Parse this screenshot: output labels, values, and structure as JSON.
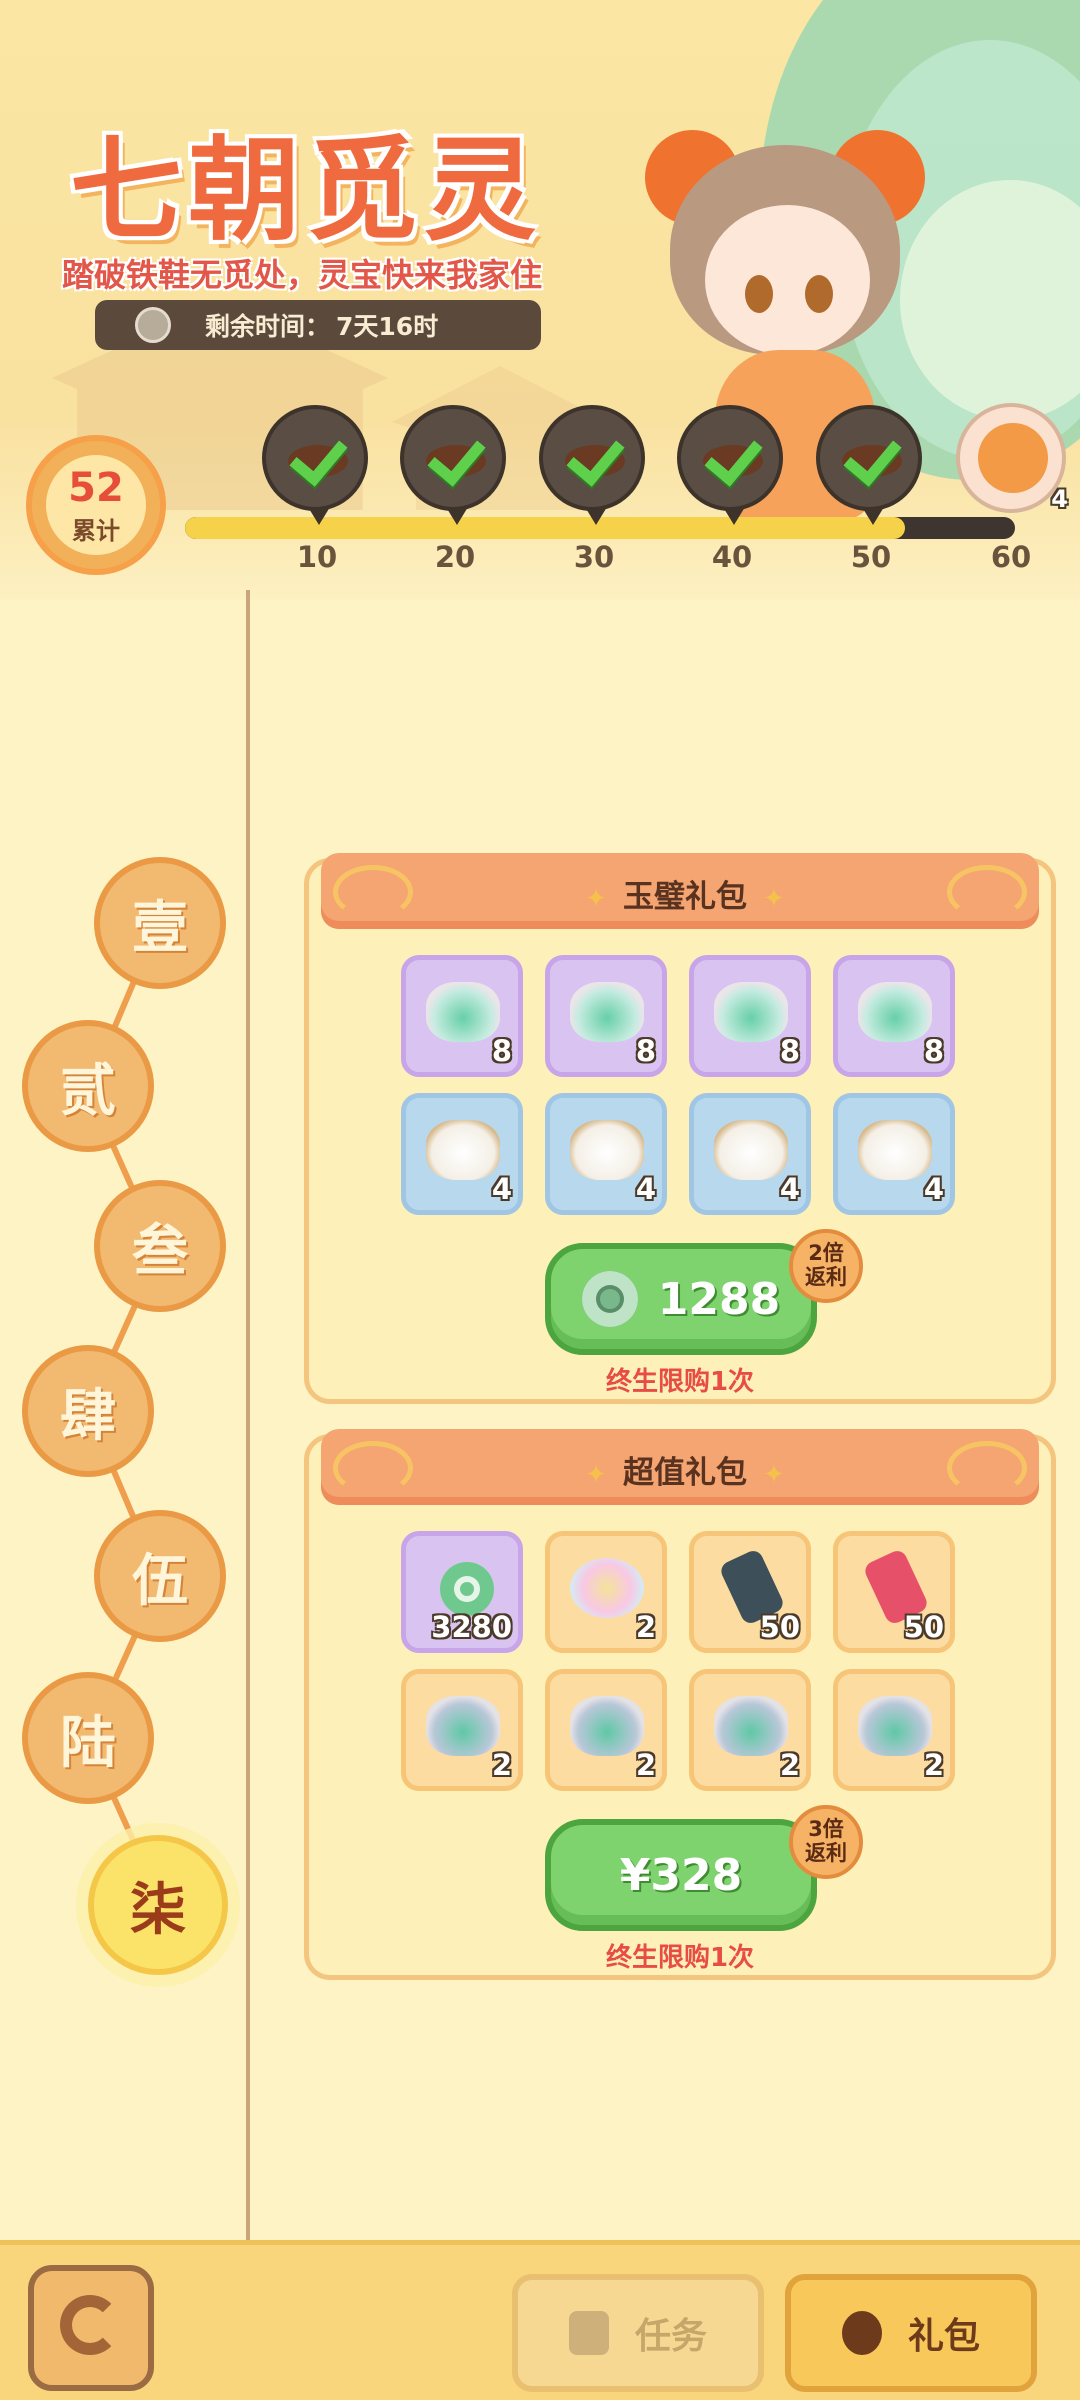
{
  "header": {
    "title": "七朝觅灵",
    "subtitle": "踏破铁鞋无觅处，灵宝快来我家住",
    "timer_label": "剩余时间：",
    "timer_value": "7天16时"
  },
  "progress": {
    "count": "52",
    "count_label": "累计",
    "fraction": 0.867,
    "milestones": [
      {
        "label": "10",
        "claimed": true
      },
      {
        "label": "20",
        "claimed": true
      },
      {
        "label": "30",
        "claimed": true
      },
      {
        "label": "40",
        "claimed": true
      },
      {
        "label": "50",
        "claimed": true
      },
      {
        "label": "60",
        "claimed": false,
        "reward_qty": "4"
      }
    ]
  },
  "chapters": [
    {
      "label": "壹"
    },
    {
      "label": "贰"
    },
    {
      "label": "叁"
    },
    {
      "label": "肆"
    },
    {
      "label": "伍"
    },
    {
      "label": "陆"
    },
    {
      "label": "柒",
      "active": true
    }
  ],
  "packs": [
    {
      "title": "玉璧礼包",
      "items": [
        {
          "icon": "jade-item-icon",
          "qty": "8",
          "bg": "purple"
        },
        {
          "icon": "jade-item-icon",
          "qty": "8",
          "bg": "purple"
        },
        {
          "icon": "jade-item-icon",
          "qty": "8",
          "bg": "purple"
        },
        {
          "icon": "jade-item-icon",
          "qty": "8",
          "bg": "purple"
        },
        {
          "icon": "rabbit-item-icon",
          "qty": "4",
          "bg": "blue"
        },
        {
          "icon": "rabbit-item-icon",
          "qty": "4",
          "bg": "blue"
        },
        {
          "icon": "rabbit-item-icon",
          "qty": "4",
          "bg": "blue"
        },
        {
          "icon": "rabbit-item-icon",
          "qty": "4",
          "bg": "blue"
        }
      ],
      "price": "1288",
      "price_icon": "jade-coin-icon",
      "rebate_line1": "2倍",
      "rebate_line2": "返利",
      "limit": "终生限购1次"
    },
    {
      "title": "超值礼包",
      "items": [
        {
          "icon": "jade-ring-icon",
          "qty": "3280",
          "bg": "purple"
        },
        {
          "icon": "crystal-item-icon",
          "qty": "2",
          "bg": "orange"
        },
        {
          "icon": "dark-scroll-icon",
          "qty": "50",
          "bg": "orange"
        },
        {
          "icon": "red-scroll-icon",
          "qty": "50",
          "bg": "orange"
        },
        {
          "icon": "rock-item-icon",
          "qty": "2",
          "bg": "orange"
        },
        {
          "icon": "rock-item-icon",
          "qty": "2",
          "bg": "orange"
        },
        {
          "icon": "rock-item-icon",
          "qty": "2",
          "bg": "orange"
        },
        {
          "icon": "rock-item-icon",
          "qty": "2",
          "bg": "orange"
        }
      ],
      "price": "¥328",
      "rebate_line1": "3倍",
      "rebate_line2": "返利",
      "limit": "终生限购1次"
    }
  ],
  "bottom": {
    "task_label": "任务",
    "gift_label": "礼包"
  },
  "colors": {
    "accent_orange": "#ef6b3f",
    "buy_green": "#7ed36e",
    "limit_red": "#e84d45",
    "background": "#fdf3c4"
  }
}
